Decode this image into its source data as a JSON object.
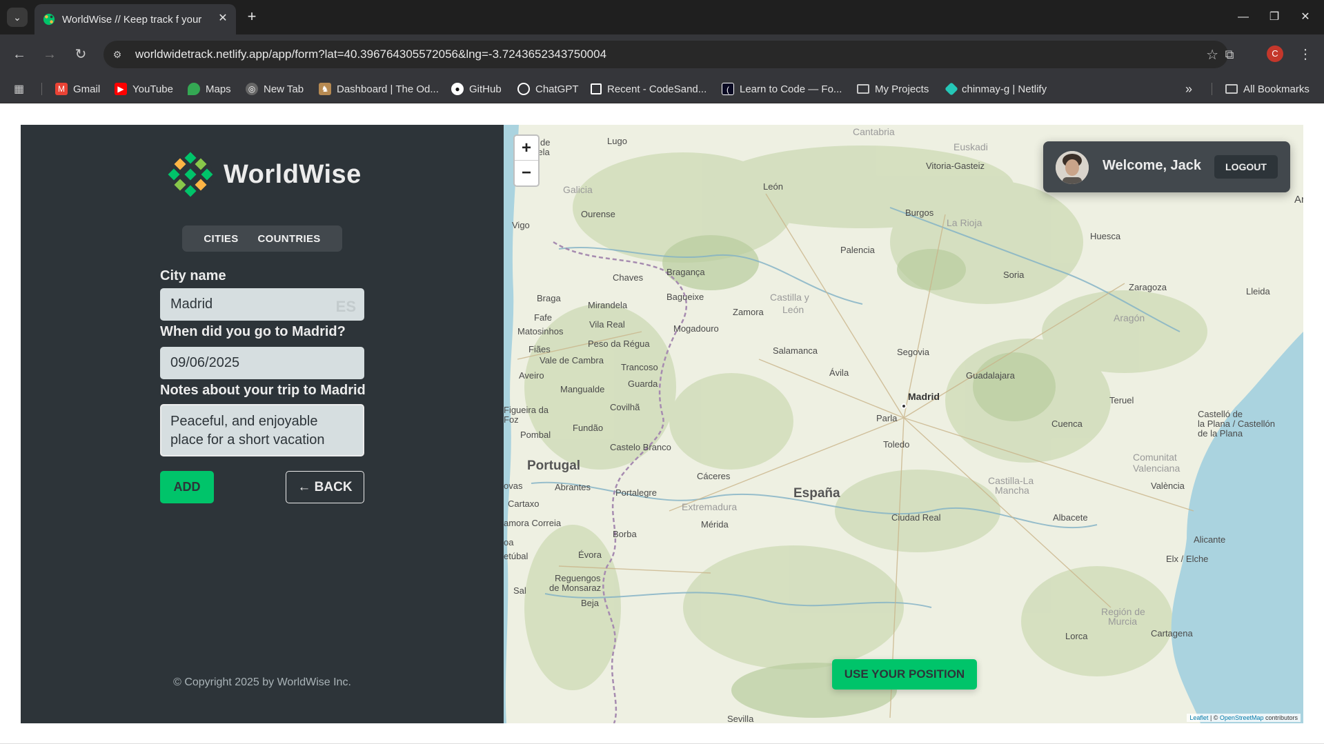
{
  "browser": {
    "tab_title": "WorldWise // Keep track f your",
    "url": "worldwidetrack.netlify.app/app/form?lat=40.396764305572056&lng=-3.7243652343750004",
    "profile_initial": "C",
    "bookmarks": [
      {
        "label": "Gmail",
        "icon": "gmail-icon",
        "color": "#ea4335"
      },
      {
        "label": "YouTube",
        "icon": "youtube-icon",
        "color": "#ff0000"
      },
      {
        "label": "Maps",
        "icon": "maps-icon",
        "color": "#34a853"
      },
      {
        "label": "New Tab",
        "icon": "globe-icon",
        "color": "#888888"
      },
      {
        "label": "Dashboard | The Od...",
        "icon": "odin-icon",
        "color": "#b78a52"
      },
      {
        "label": "GitHub",
        "icon": "github-icon",
        "color": "#ffffff"
      },
      {
        "label": "ChatGPT",
        "icon": "chatgpt-icon",
        "color": "#ffffff"
      },
      {
        "label": "Recent - CodeSand...",
        "icon": "codesandbox-icon",
        "color": "#ffffff"
      },
      {
        "label": "Learn to Code — Fo...",
        "icon": "freecodecamp-icon",
        "color": "#ffffff"
      },
      {
        "label": "My Projects",
        "icon": "folder-icon",
        "color": "#c9c9c9"
      },
      {
        "label": "chinmay-g | Netlify",
        "icon": "netlify-icon",
        "color": "#25c7b7"
      }
    ],
    "all_bookmarks": "All Bookmarks"
  },
  "app": {
    "brand": "WorldWise",
    "tabs": [
      "CITIES",
      "COUNTRIES"
    ],
    "form": {
      "city_label": "City name",
      "city_value": "Madrid",
      "flag_text": "ES",
      "date_label": "When did you go to Madrid?",
      "date_value": "09/06/2025",
      "notes_label": "Notes about your trip to Madrid",
      "notes_value": "Peaceful, and enjoyable place for a short vacation",
      "add_label": "ADD",
      "back_label": "← BACK"
    },
    "copyright": "© Copyright 2025 by WorldWise Inc."
  },
  "map": {
    "zoom_in": "+",
    "zoom_out": "−",
    "user": {
      "welcome": "Welcome, Jack",
      "logout": "LOGOUT"
    },
    "use_position": "USE YOUR POSITION",
    "attribution": {
      "leaflet": "Leaflet",
      "sep": " | © ",
      "osm": "OpenStreetMap",
      "contrib": " contributors"
    },
    "places": [
      {
        "name": "Lugo",
        "kind": "city"
      },
      {
        "name": "ntiago de",
        "kind": "city"
      },
      {
        "name": "mpostela",
        "kind": "city"
      },
      {
        "name": "Cantabria",
        "kind": "region"
      },
      {
        "name": "Euskadi",
        "kind": "region"
      },
      {
        "name": "Vitoria-Gasteiz",
        "kind": "city"
      },
      {
        "name": "Galicia",
        "kind": "region"
      },
      {
        "name": "León",
        "kind": "city"
      },
      {
        "name": "Burgos",
        "kind": "city"
      },
      {
        "name": "La Rioja",
        "kind": "region"
      },
      {
        "name": "Ourense",
        "kind": "city"
      },
      {
        "name": "Vigo",
        "kind": "city"
      },
      {
        "name": "Palencia",
        "kind": "city"
      },
      {
        "name": "Huesca",
        "kind": "city"
      },
      {
        "name": "Chaves",
        "kind": "city"
      },
      {
        "name": "Bragança",
        "kind": "city"
      },
      {
        "name": "Soria",
        "kind": "city"
      },
      {
        "name": "Zaragoza",
        "kind": "city"
      },
      {
        "name": "Braga",
        "kind": "city"
      },
      {
        "name": "Mirandela",
        "kind": "city"
      },
      {
        "name": "Bagueixe",
        "kind": "city"
      },
      {
        "name": "Castilla y",
        "kind": "region"
      },
      {
        "name": "León",
        "kind": "region"
      },
      {
        "name": "Lleida",
        "kind": "city"
      },
      {
        "name": "Fafe",
        "kind": "city"
      },
      {
        "name": "Vila Real",
        "kind": "city"
      },
      {
        "name": "Zamora",
        "kind": "city"
      },
      {
        "name": "Aragón",
        "kind": "region"
      },
      {
        "name": "Matosinhos",
        "kind": "city"
      },
      {
        "name": "Mogadouro",
        "kind": "city"
      },
      {
        "name": "Peso da Régua",
        "kind": "city"
      },
      {
        "name": "Fiães",
        "kind": "city"
      },
      {
        "name": "Salamanca",
        "kind": "city"
      },
      {
        "name": "Segovia",
        "kind": "city"
      },
      {
        "name": "Vale de Cambra",
        "kind": "city"
      },
      {
        "name": "Trancoso",
        "kind": "city"
      },
      {
        "name": "Ávila",
        "kind": "city"
      },
      {
        "name": "Guadalajara",
        "kind": "city"
      },
      {
        "name": "Aveiro",
        "kind": "city"
      },
      {
        "name": "Guarda",
        "kind": "city"
      },
      {
        "name": "Mangualde",
        "kind": "city"
      },
      {
        "name": "Madrid",
        "kind": "capital"
      },
      {
        "name": "Teruel",
        "kind": "city"
      },
      {
        "name": "Covilhã",
        "kind": "city"
      },
      {
        "name": "Figueira da",
        "kind": "city"
      },
      {
        "name": "Foz",
        "kind": "city"
      },
      {
        "name": "Parla",
        "kind": "city"
      },
      {
        "name": "Fundão",
        "kind": "city"
      },
      {
        "name": "Cuenca",
        "kind": "city"
      },
      {
        "name": "Castelló de",
        "kind": "city"
      },
      {
        "name": "la Plana / Castellón",
        "kind": "city"
      },
      {
        "name": "de la Plana",
        "kind": "city"
      },
      {
        "name": "Pombal",
        "kind": "city"
      },
      {
        "name": "Toledo",
        "kind": "city"
      },
      {
        "name": "Castelo Branco",
        "kind": "city"
      },
      {
        "name": "Portugal",
        "kind": "country"
      },
      {
        "name": "Comunitat",
        "kind": "region"
      },
      {
        "name": "Valenciana",
        "kind": "region"
      },
      {
        "name": "Cáceres",
        "kind": "city"
      },
      {
        "name": "Castilla-La",
        "kind": "region"
      },
      {
        "name": "Mancha",
        "kind": "region"
      },
      {
        "name": "ovas",
        "kind": "city"
      },
      {
        "name": "Abrantes",
        "kind": "city"
      },
      {
        "name": "Portalegre",
        "kind": "city"
      },
      {
        "name": "España",
        "kind": "country"
      },
      {
        "name": "València",
        "kind": "city"
      },
      {
        "name": "Cartaxo",
        "kind": "city"
      },
      {
        "name": "Extremadura",
        "kind": "region"
      },
      {
        "name": "Ciudad Real",
        "kind": "city"
      },
      {
        "name": "Albacete",
        "kind": "city"
      },
      {
        "name": "amora Correia",
        "kind": "city"
      },
      {
        "name": "Mérida",
        "kind": "city"
      },
      {
        "name": "Borba",
        "kind": "city"
      },
      {
        "name": "Évora",
        "kind": "city"
      },
      {
        "name": "oa",
        "kind": "city"
      },
      {
        "name": "etúbal",
        "kind": "city"
      },
      {
        "name": "Alicante",
        "kind": "city"
      },
      {
        "name": "Elx / Elche",
        "kind": "city"
      },
      {
        "name": "Reguengos",
        "kind": "city"
      },
      {
        "name": "de Monsaraz",
        "kind": "city"
      },
      {
        "name": "Sal",
        "kind": "city"
      },
      {
        "name": "Beja",
        "kind": "city"
      },
      {
        "name": "Región de",
        "kind": "region"
      },
      {
        "name": "Murcia",
        "kind": "region"
      },
      {
        "name": "Lorca",
        "kind": "city"
      },
      {
        "name": "Cartagena",
        "kind": "city"
      },
      {
        "name": "Sevilla",
        "kind": "city"
      },
      {
        "name": "Ar",
        "kind": "city"
      }
    ]
  },
  "colors": {
    "sidebar": "#2d3439",
    "accent": "#00c46a",
    "input": "#d6dee0"
  }
}
